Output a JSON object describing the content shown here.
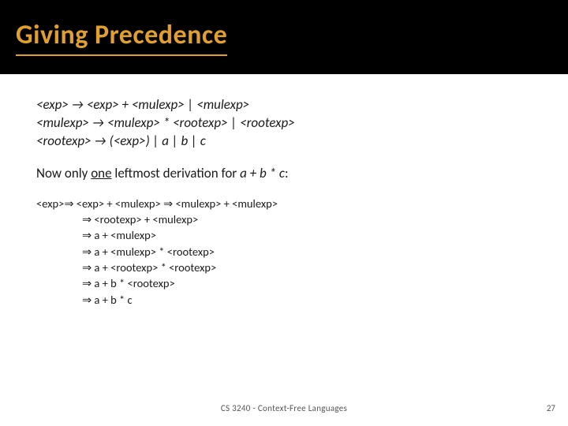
{
  "title": "Giving Precedence",
  "grammar": {
    "line1": "<exp> → <exp> + <mulexp> | <mulexp>",
    "line2": "<mulexp> → <mulexp> * <rootexp> | <rootexp>",
    "line3": "<rootexp> → (<exp>) | a | b | c"
  },
  "desc_prefix": "Now only ",
  "desc_underlined": "one",
  "desc_mid": " leftmost derivation for ",
  "desc_expr": "a + b * c",
  "desc_end": ":",
  "derivation": {
    "head": "<exp> ",
    "step0": "⇒ <exp> + <mulexp> ⇒ <mulexp> + <mulexp>",
    "step1": "⇒ <rootexp> + <mulexp>",
    "step2": "⇒ a + <mulexp>",
    "step3": "⇒ a + <mulexp> * <rootexp>",
    "step4": "⇒ a + <rootexp> * <rootexp>",
    "step5": "⇒ a + b * <rootexp>",
    "step6": "⇒ a + b * c"
  },
  "footer": "CS 3240 - Context-Free Languages",
  "page": "27"
}
